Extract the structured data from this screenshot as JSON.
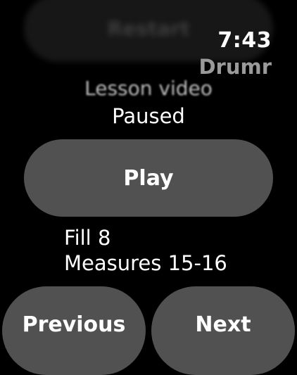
{
  "background_restart": {
    "label": "Restart"
  },
  "status": {
    "time": "7:43",
    "app_name": "Drumr"
  },
  "lesson": {
    "title": "Lesson video",
    "state": "Paused"
  },
  "controls": {
    "play_label": "Play",
    "previous_label": "Previous",
    "next_label": "Next"
  },
  "fill": {
    "name": "Fill 8",
    "measures": "Measures 15-16"
  },
  "colors": {
    "background": "#000000",
    "button": "#515151",
    "app_name": "#9a9a9a",
    "text": "#ffffff"
  }
}
